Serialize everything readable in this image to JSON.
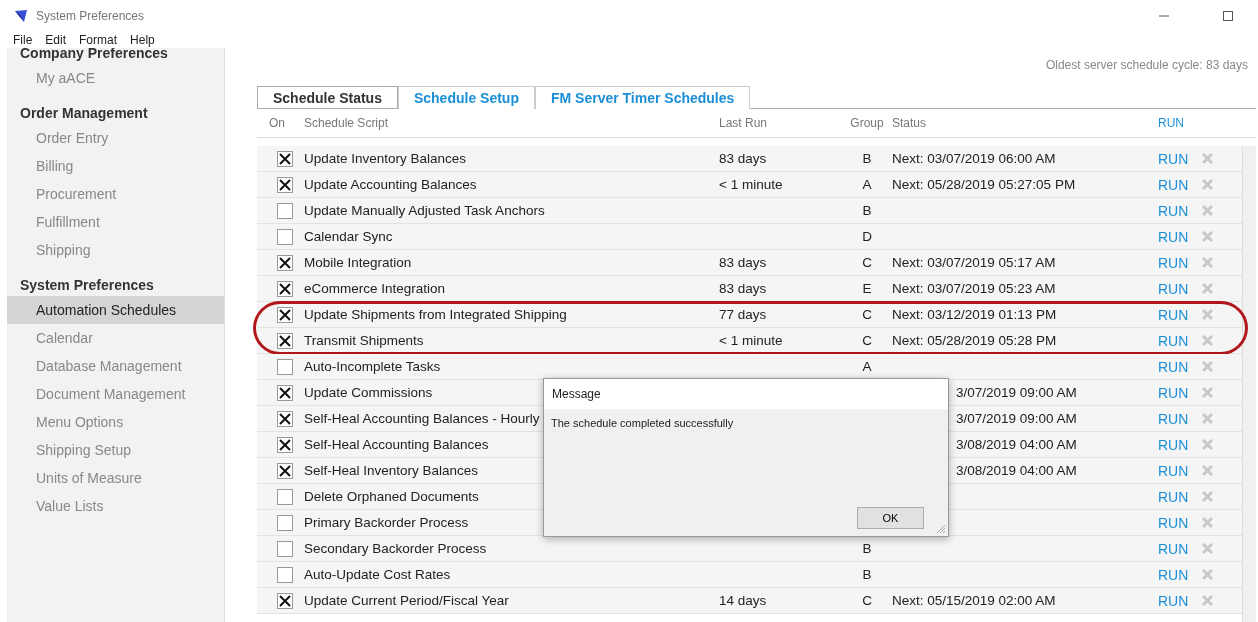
{
  "window": {
    "title": "System Preferences"
  },
  "menu": [
    "File",
    "Edit",
    "Format",
    "Help"
  ],
  "sidebar": [
    {
      "heading": "Company Preferences",
      "items": [
        {
          "label": "My aACE",
          "selected": false
        }
      ]
    },
    {
      "heading": "Order Management",
      "items": [
        {
          "label": "Order Entry",
          "selected": false
        },
        {
          "label": "Billing",
          "selected": false
        },
        {
          "label": "Procurement",
          "selected": false
        },
        {
          "label": "Fulfillment",
          "selected": false
        },
        {
          "label": "Shipping",
          "selected": false
        }
      ]
    },
    {
      "heading": "System Preferences",
      "items": [
        {
          "label": "Automation Schedules",
          "selected": true
        },
        {
          "label": "Calendar",
          "selected": false
        },
        {
          "label": "Database Management",
          "selected": false
        },
        {
          "label": "Document Management",
          "selected": false
        },
        {
          "label": "Menu Options",
          "selected": false
        },
        {
          "label": "Shipping Setup",
          "selected": false
        },
        {
          "label": "Units of Measure",
          "selected": false
        },
        {
          "label": "Value Lists",
          "selected": false
        }
      ]
    }
  ],
  "server_cycle": "Oldest server schedule cycle: 83 days",
  "tabs": [
    {
      "label": "Schedule Status",
      "selected": true
    },
    {
      "label": "Schedule Setup",
      "selected": false
    },
    {
      "label": "FM Server Timer Schedules",
      "selected": false
    }
  ],
  "table": {
    "columns": [
      "On",
      "Schedule Script",
      "Last Run",
      "Group",
      "Status",
      "RUN"
    ],
    "rows": [
      {
        "on": true,
        "script": "Update Inventory Balances",
        "last_run": "83 days",
        "group": "B",
        "status": "Next: 03/07/2019 06:00 AM",
        "run": "RUN",
        "highlighted": false
      },
      {
        "on": true,
        "script": "Update Accounting Balances",
        "last_run": "< 1 minute",
        "group": "A",
        "status": "Next: 05/28/2019 05:27:05 PM",
        "run": "RUN",
        "highlighted": false
      },
      {
        "on": false,
        "script": "Update Manually Adjusted Task Anchors",
        "group": "B",
        "run": "RUN",
        "highlighted": false
      },
      {
        "on": false,
        "script": "Calendar Sync",
        "group": "D",
        "run": "RUN",
        "highlighted": false
      },
      {
        "on": true,
        "script": "Mobile Integration",
        "last_run": "83 days",
        "group": "C",
        "status": "Next: 03/07/2019 05:17 AM",
        "run": "RUN",
        "highlighted": false
      },
      {
        "on": true,
        "script": "eCommerce Integration",
        "last_run": "83 days",
        "group": "E",
        "status": "Next: 03/07/2019 05:23 AM",
        "run": "RUN",
        "highlighted": false
      },
      {
        "on": true,
        "script": "Update Shipments from Integrated Shipping",
        "last_run": "77 days",
        "group": "C",
        "status": "Next: 03/12/2019 01:13 PM",
        "run": "RUN",
        "highlighted": true
      },
      {
        "on": true,
        "script": "Transmit Shipments",
        "last_run": "< 1 minute",
        "group": "C",
        "status": "Next: 05/28/2019 05:28 PM",
        "run": "RUN",
        "highlighted": true
      },
      {
        "on": false,
        "script": "Auto-Incomplete Tasks",
        "group": "A",
        "run": "RUN",
        "highlighted": false
      },
      {
        "on": true,
        "script": "Update Commissions",
        "status": "3/07/2019 09:00 AM",
        "covered": true,
        "run": "RUN",
        "highlighted": false
      },
      {
        "on": true,
        "script": "Self-Heal Accounting Balances - Hourly",
        "status": "3/07/2019 09:00 AM",
        "covered": true,
        "run": "RUN",
        "highlighted": false
      },
      {
        "on": true,
        "script": "Self-Heal Accounting Balances",
        "status": "3/08/2019 04:00 AM",
        "covered": true,
        "run": "RUN",
        "highlighted": false
      },
      {
        "on": true,
        "script": "Self-Heal Inventory Balances",
        "status": "3/08/2019 04:00 AM",
        "covered": true,
        "run": "RUN",
        "highlighted": false
      },
      {
        "on": false,
        "script": "Delete Orphaned Documents",
        "run": "RUN",
        "highlighted": false
      },
      {
        "on": false,
        "script": "Primary Backorder Process",
        "run": "RUN",
        "highlighted": false
      },
      {
        "on": false,
        "script": "Secondary Backorder Process",
        "group": "B",
        "run": "RUN",
        "highlighted": false
      },
      {
        "on": false,
        "script": "Auto-Update Cost Rates",
        "group": "B",
        "run": "RUN",
        "highlighted": false
      },
      {
        "on": true,
        "script": "Update Current Period/Fiscal Year",
        "last_run": "14 days",
        "group": "C",
        "status": "Next: 05/15/2019 02:00 AM",
        "run": "RUN",
        "highlighted": false
      }
    ]
  },
  "dialog": {
    "title": "Message",
    "message": "The schedule completed successfully",
    "button": "OK"
  }
}
